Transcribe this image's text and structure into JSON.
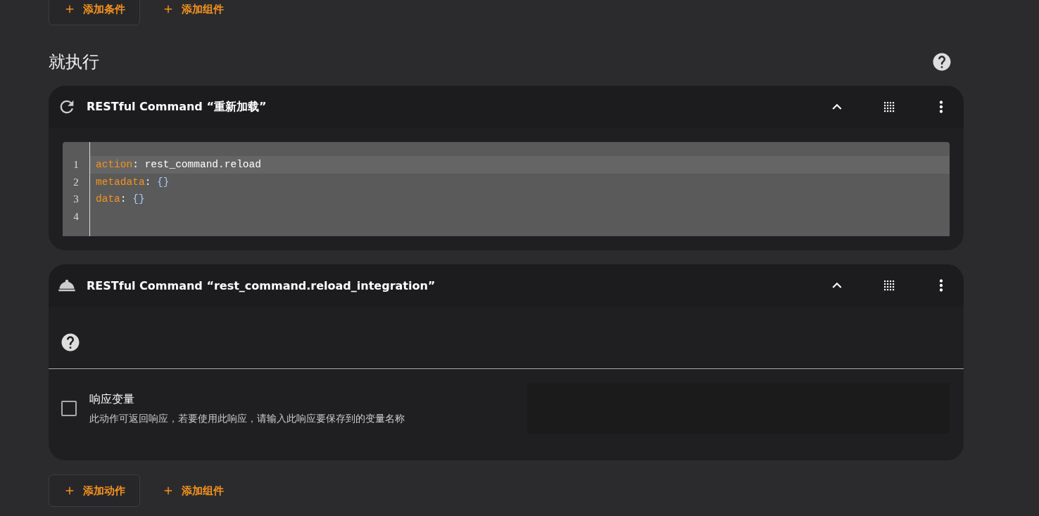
{
  "condition_buttons": [
    {
      "label": "添加条件",
      "kind": "outlined"
    },
    {
      "label": "添加组件",
      "kind": "text"
    }
  ],
  "section": {
    "title": "就执行"
  },
  "actions": [
    {
      "kind": "yaml",
      "title": "RESTful Command “重新加载”",
      "expanded": true,
      "lines": [
        {
          "number": "1",
          "key": "action",
          "separator": ":",
          "value": "rest_command.reload",
          "selected": true
        },
        {
          "number": "2",
          "key": "metadata",
          "separator": ":",
          "value": "{}",
          "selected": false
        },
        {
          "number": "3",
          "key": "data",
          "separator": ":",
          "value": "{}",
          "selected": false
        },
        {
          "number": "4"
        }
      ]
    },
    {
      "kind": "form",
      "title": "RESTful Command “rest_command.reload_integration”",
      "expanded": true,
      "response": {
        "label": "响应变量",
        "description": "此动作可返回响应，若要使用此响应，请输入此响应要保存到的变量名称",
        "checked": false
      }
    }
  ],
  "action_buttons": [
    {
      "label": "添加动作",
      "kind": "outlined"
    },
    {
      "label": "添加组件",
      "kind": "text"
    }
  ]
}
